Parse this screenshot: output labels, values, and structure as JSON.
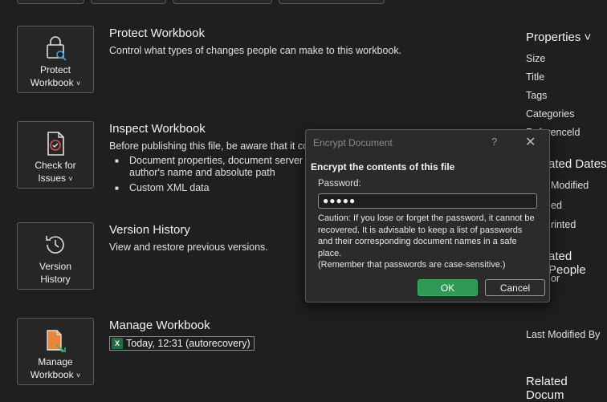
{
  "tiles": {
    "protect": {
      "line1": "Protect",
      "line2": "Workbook"
    },
    "inspect": {
      "line1": "Check for",
      "line2": "Issues"
    },
    "version": {
      "line1": "Version",
      "line2": "History"
    },
    "manage": {
      "line1": "Manage",
      "line2": "Workbook"
    },
    "chevron": "˅"
  },
  "sections": {
    "protect": {
      "title": "Protect Workbook",
      "desc": "Control what types of changes people can make to this workbook."
    },
    "inspect": {
      "title": "Inspect Workbook",
      "desc": "Before publishing this file, be aware that it con",
      "bullets": [
        "Document properties, document server pr",
        "author's name and absolute path",
        "Custom XML data"
      ]
    },
    "version": {
      "title": "Version History",
      "desc": "View and restore previous versions."
    },
    "manage": {
      "title": "Manage Workbook",
      "file_entry": "Today, 12:31 (autorecovery)",
      "file_icon": "X"
    }
  },
  "properties": {
    "header": "Properties ˅",
    "items": [
      "Size",
      "Title",
      "Tags",
      "Categories",
      "Referenceld"
    ],
    "related_dates_header": "ated Dates",
    "dates": [
      "Modified",
      "ed",
      "rinted"
    ],
    "related_people_header": "ated People",
    "people": [
      "or"
    ],
    "last_modified_by": "Last Modified By",
    "related_docs_header": "Related Docum"
  },
  "dialog": {
    "title": "Encrypt Document",
    "help": "?",
    "close": "✕",
    "heading": "Encrypt the contents of this file",
    "password_label": "Password:",
    "password_value": "●●●●●",
    "caution": "Caution: If you lose or forget the password, it cannot be recovered. It is advisable to keep a list of passwords and their corresponding document names in a safe place.",
    "reminder": "(Remember that passwords are case-sensitive.)",
    "ok": "OK",
    "cancel": "Cancel"
  }
}
